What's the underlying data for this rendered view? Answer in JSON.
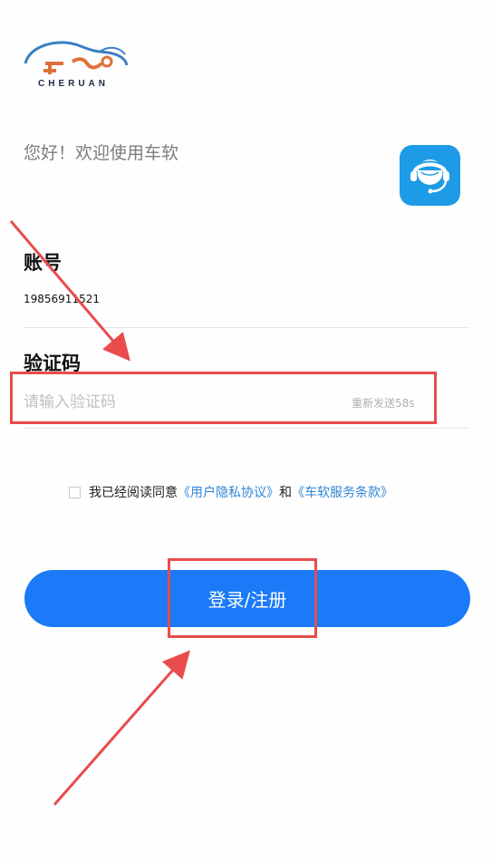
{
  "logo": {
    "text": "CHERUAN",
    "icon": "car-wrench-logo"
  },
  "greeting": "您好！欢迎使用车软",
  "support_icon": "customer-service-headset-icon",
  "account": {
    "label": "账号",
    "value": "19856911521"
  },
  "code": {
    "label": "验证码",
    "placeholder": "请输入验证码",
    "resend": "重新发送58s"
  },
  "agreement": {
    "checked": false,
    "prefix": "我已经阅读同意",
    "privacy_link": "《用户隐私协议》",
    "conjunction": "和",
    "terms_link": "《车软服务条款》"
  },
  "login_button": "登录/注册",
  "colors": {
    "primary": "#1a7af8",
    "link": "#2f86d6",
    "annotation": "#e84c4c",
    "support_bg": "#1e9be6",
    "logo_blue": "#3a7fc4",
    "logo_orange": "#e0703a"
  }
}
